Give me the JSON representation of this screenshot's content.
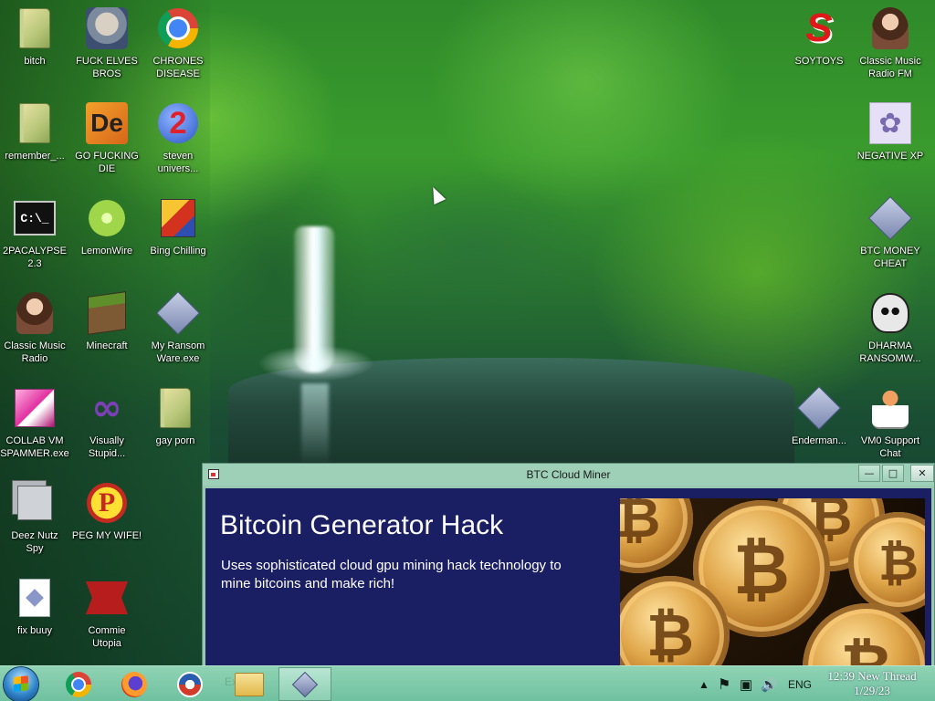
{
  "desktop": {
    "icons": [
      {
        "label": "bitch",
        "icon": "folder-icon"
      },
      {
        "label": "FUCK ELVES\nBROS",
        "icon": "elf-face-icon"
      },
      {
        "label": "CHRONES\nDISEASE",
        "icon": "chrome-icon"
      },
      {
        "label": "remember_...",
        "icon": "folder-icon"
      },
      {
        "label": "GO FUCKING\nDIE",
        "icon": "de-logo-icon"
      },
      {
        "label": "steven\nunivers...",
        "icon": "number-two-icon"
      },
      {
        "label": "2PACALYPSE\n2.3",
        "icon": "command-prompt-icon"
      },
      {
        "label": "LemonWire",
        "icon": "lime-icon"
      },
      {
        "label": "Bing Chilling",
        "icon": "software-box-icon"
      },
      {
        "label": "Classic Music\nRadio",
        "icon": "portrait-icon"
      },
      {
        "label": "Minecraft",
        "icon": "grass-block-icon"
      },
      {
        "label": "My Ransom\nWare.exe",
        "icon": "program-diamond-icon"
      },
      {
        "label": "COLLAB VM\nSPAMMER.exe",
        "icon": "pink-app-icon"
      },
      {
        "label": "Visually\nStupid...",
        "icon": "visual-studio-icon"
      },
      {
        "label": "gay porn",
        "icon": "folder-icon"
      },
      {
        "label": "Deez Nutz\nSpy",
        "icon": "window-stack-icon"
      },
      {
        "label": "PEG MY WIFE!",
        "icon": "p-logo-icon"
      },
      {
        "label": "fix buuy",
        "icon": "document-icon"
      },
      {
        "label": "Commie\nUtopia",
        "icon": "red-banner-icon"
      },
      {
        "label": "SOYTOYS",
        "icon": "red-s-logo-icon"
      },
      {
        "label": "Classic Music\nRadio FM",
        "icon": "portrait-icon"
      },
      {
        "label": "NEGATIVE XP",
        "icon": "bunny-icon"
      },
      {
        "label": "BTC MONEY\nCHEAT",
        "icon": "program-diamond-icon"
      },
      {
        "label": "DHARMA\nRANSOMW...",
        "icon": "skull-icon"
      },
      {
        "label": "Enderman...",
        "icon": "program-diamond-icon"
      },
      {
        "label": "VM0 Support\nChat",
        "icon": "doctor-icon"
      }
    ]
  },
  "window": {
    "title": "BTC Cloud Miner",
    "buttons": {
      "minimize": "—",
      "maximize": "□",
      "close": "✕"
    },
    "heading": "Bitcoin Generator Hack",
    "description": "Uses sophisticated cloud gpu mining hack technology to mine bitcoins and make rich!",
    "image_icon": "bitcoin-coins-image",
    "coin_symbol": "₿"
  },
  "taskbar": {
    "start_icon": "windows-start-icon",
    "pinned": [
      "chrome-icon",
      "firefox-icon",
      "obama-logo-icon",
      "file-explorer-icon",
      "btc-miner-app-icon"
    ],
    "ghost_text": "Explod",
    "tray": {
      "show_hidden": "▲",
      "flag": "⚑",
      "network": "▣",
      "volume": "🔊",
      "language": "ENG"
    },
    "clock": {
      "time": "12:39 New Thread",
      "date": "1/29/23"
    }
  },
  "colors": {
    "window_content_bg": "#1a1f63",
    "titlebar": "#9ed0b8",
    "taskbar": "#7cc9a8"
  }
}
